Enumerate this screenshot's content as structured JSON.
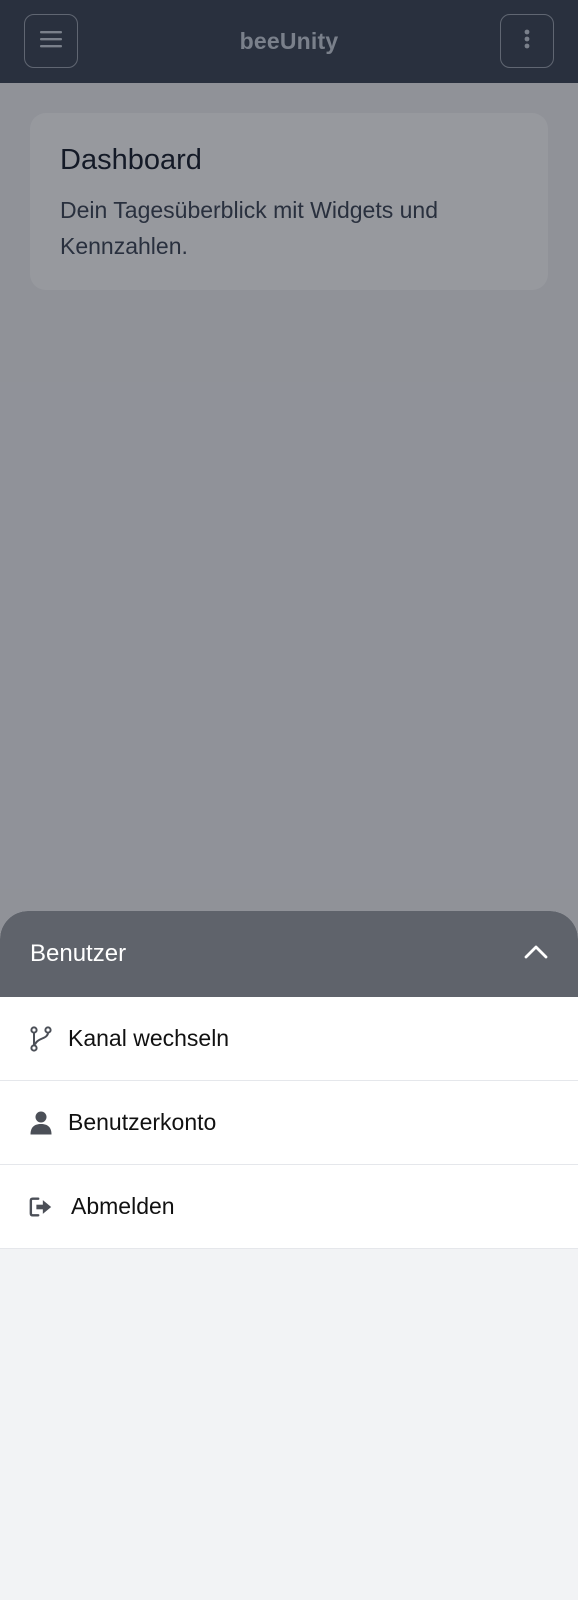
{
  "app": {
    "title": "beeUnity"
  },
  "topbar": {
    "menu_icon": "hamburger-menu-icon",
    "more_icon": "vertical-dots-icon"
  },
  "dashboard": {
    "title": "Dashboard",
    "description": "Dein Tagesüberblick mit Widgets und Kennzahlen."
  },
  "user_sheet": {
    "title": "Benutzer",
    "collapse_icon": "chevron-up-icon",
    "items": [
      {
        "label": "Kanal wechseln",
        "icon": "branch-icon"
      },
      {
        "label": "Benutzerkonto",
        "icon": "user-icon"
      },
      {
        "label": "Abmelden",
        "icon": "sign-out-icon"
      }
    ]
  },
  "colors": {
    "topbar": "#374151",
    "sheet_header": "#5f636b",
    "overlay": "rgba(24,28,40,0.45)",
    "background": "#f2f3f5"
  }
}
